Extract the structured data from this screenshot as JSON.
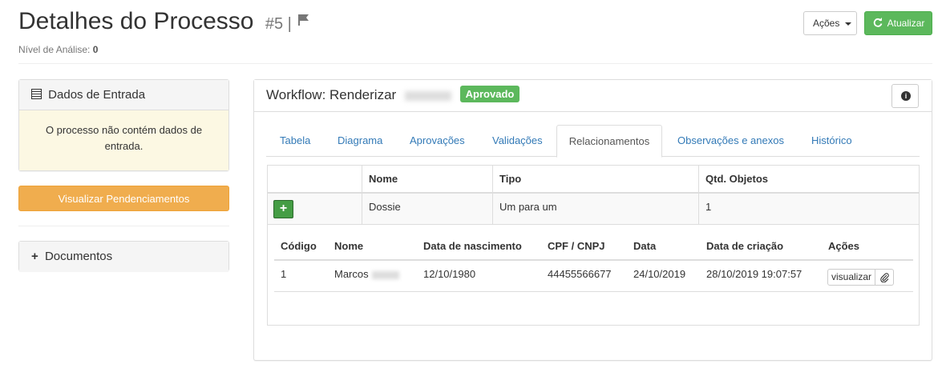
{
  "header": {
    "title": "Detalhes do Processo",
    "process_number": "#5",
    "separator": "|",
    "analysis_label": "Nível de Análise:",
    "analysis_value": "0",
    "actions_button": "Ações",
    "refresh_button": "Atualizar"
  },
  "entrada": {
    "title": "Dados de Entrada",
    "message": "O processo não contém dados de entrada."
  },
  "pendencias_button": "Visualizar Pendenciamentos",
  "documentos": {
    "title": "Documentos"
  },
  "workflow": {
    "label": "Workflow: Renderizar",
    "status_badge": "Aprovado",
    "tabs": [
      {
        "label": "Tabela"
      },
      {
        "label": "Diagrama"
      },
      {
        "label": "Aprovações"
      },
      {
        "label": "Validações"
      },
      {
        "label": "Relacionamentos"
      },
      {
        "label": "Observações e anexos"
      },
      {
        "label": "Histórico"
      }
    ],
    "active_tab": "Relacionamentos"
  },
  "relacionamentos": {
    "columns": [
      "Nome",
      "Tipo",
      "Qtd. Objetos"
    ],
    "row": {
      "nome": "Dossie",
      "tipo": "Um para um",
      "qtd": "1"
    },
    "add_symbol": "+"
  },
  "objetos": {
    "columns": [
      "Código",
      "Nome",
      "Data de nascimento",
      "CPF / CNPJ",
      "Data",
      "Data de criação",
      "Ações"
    ],
    "rows": [
      {
        "codigo": "1",
        "nome": "Marcos",
        "nascimento": "12/10/1980",
        "cpf": "44455566677",
        "data": "24/10/2019",
        "criacao": "28/10/2019 19:07:57",
        "acao": "visualizar"
      }
    ]
  },
  "colors": {
    "success": "#5cb85c",
    "warning": "#f0ad4e",
    "link": "#337ab7",
    "info_bg": "#fcf8e3"
  }
}
